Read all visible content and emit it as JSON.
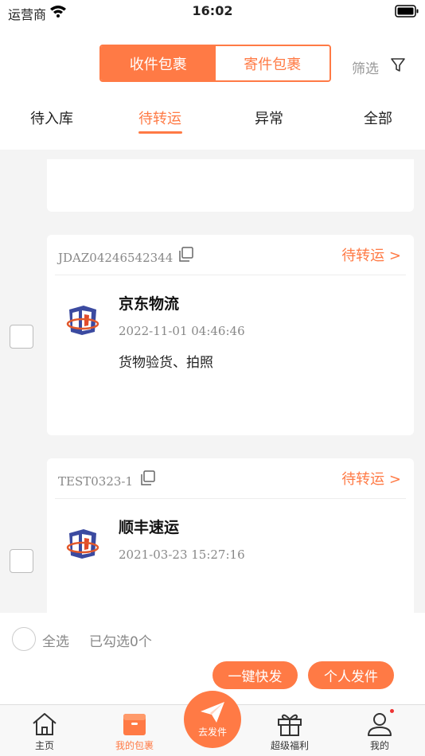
{
  "status_bar": {
    "carrier": "运营商",
    "time": "16:02"
  },
  "segment": {
    "receive": "收件包裹",
    "send": "寄件包裹"
  },
  "filter_label": "筛选",
  "tabs": [
    "待入库",
    "待转运",
    "异常",
    "全部"
  ],
  "parcels": [
    {
      "tracking": "JDAZ04246542344",
      "status": "待转运 >",
      "carrier": "京东物流",
      "time": "2022-11-01 04:46:46",
      "desc": "货物验货、拍照"
    },
    {
      "tracking": "TEST0323-1",
      "status": "待转运 >",
      "carrier": "顺丰速运",
      "time": "2021-03-23 15:27:16",
      "desc": ""
    }
  ],
  "bottom": {
    "select_all": "全选",
    "selected_count": "已勾选0个",
    "quick_send": "一键快发",
    "personal_send": "个人发件"
  },
  "tabbar": {
    "home": "主页",
    "my_parcels": "我的包裹",
    "send": "去发件",
    "benefits": "超级福利",
    "me": "我的"
  },
  "colors": {
    "accent": "#ff7a45",
    "text": "#222222",
    "muted": "#888888",
    "background": "#f4f4f4"
  },
  "icons": [
    "wifi-icon",
    "battery-icon",
    "filter-icon",
    "copy-icon",
    "carrier-logo",
    "home-icon",
    "box-icon",
    "paper-plane-icon",
    "gift-icon",
    "user-icon"
  ]
}
